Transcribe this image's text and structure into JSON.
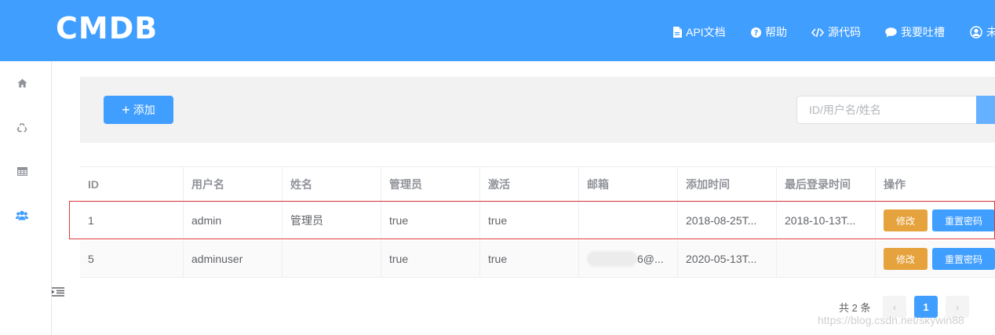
{
  "header": {
    "logo": "CMDB",
    "nav": [
      {
        "label": "API文档",
        "icon": "document-icon"
      },
      {
        "label": "帮助",
        "icon": "question-circle-icon"
      },
      {
        "label": "源代码",
        "icon": "code-icon"
      },
      {
        "label": "我要吐槽",
        "icon": "comment-icon"
      },
      {
        "label": "未",
        "icon": "user-circle-icon"
      }
    ]
  },
  "sidebar": {
    "items": [
      {
        "icon": "home-icon"
      },
      {
        "icon": "recycle-icon"
      },
      {
        "icon": "table-icon"
      },
      {
        "icon": "users-icon",
        "active": true
      }
    ]
  },
  "toolbar": {
    "add_label": "添加",
    "search_placeholder": "ID/用户名/姓名"
  },
  "table": {
    "columns": [
      "ID",
      "用户名",
      "姓名",
      "管理员",
      "激活",
      "邮箱",
      "添加时间",
      "最后登录时间",
      "操作"
    ],
    "rows": [
      {
        "id": "1",
        "username": "admin",
        "name": "管理员",
        "admin": "true",
        "active": "true",
        "email": "",
        "added": "2018-08-25T...",
        "last_login": "2018-10-13T..."
      },
      {
        "id": "5",
        "username": "adminuser",
        "name": "",
        "admin": "true",
        "active": "true",
        "email": "6@...",
        "added": "2020-05-13T...",
        "last_login": ""
      }
    ],
    "edit_label": "修改",
    "reset_label": "重置密码"
  },
  "pagination": {
    "total": "共 2 条",
    "current_page": "1",
    "prev": "‹",
    "next": "›"
  },
  "watermark": "https://blog.csdn.net/skywin88",
  "colors": {
    "primary": "#409eff",
    "warning": "#e6a23c",
    "highlight_border": "#e03a3a"
  }
}
